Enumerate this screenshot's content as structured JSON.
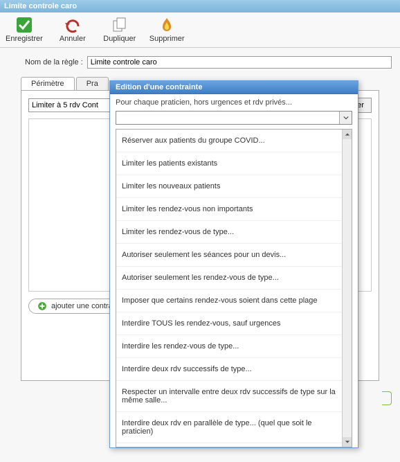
{
  "window": {
    "title": "Limite controle caro"
  },
  "toolbar": {
    "save_label": "Enregistrer",
    "cancel_label": "Annuler",
    "duplicate_label": "Dupliquer",
    "delete_label": "Supprimer"
  },
  "rule_name": {
    "label": "Nom de la règle :",
    "value": "Limite controle caro"
  },
  "tabs": [
    {
      "label": "Périmètre"
    },
    {
      "label": "Pra"
    }
  ],
  "constraint_row": {
    "text_value": "Limiter à 5 rdv Cont",
    "param_label": "Paramétrer"
  },
  "add_button_label": "ajouter une contrai",
  "popup": {
    "title": "Edition d'une contrainte",
    "subtitle": "Pour chaque praticien, hors urgences et rdv privés...",
    "combo_value": "",
    "options": [
      "Réserver aux patients du groupe COVID...",
      "Limiter les patients existants",
      "Limiter les nouveaux patients",
      "Limiter les rendez-vous non importants",
      "Limiter les rendez-vous de type...",
      "Autoriser seulement les séances pour un devis...",
      "Autoriser seulement les rendez-vous de type...",
      "Imposer que certains rendez-vous soient dans cette plage",
      "Interdire TOUS les rendez-vous, sauf urgences",
      "Interdire les rendez-vous de type...",
      "Interdire deux rdv successifs de type...",
      "Respecter un intervalle entre deux rdv successifs de type sur la même salle...",
      "Interdire deux rdv en parallèle de type... (quel que soit le praticien)"
    ]
  }
}
